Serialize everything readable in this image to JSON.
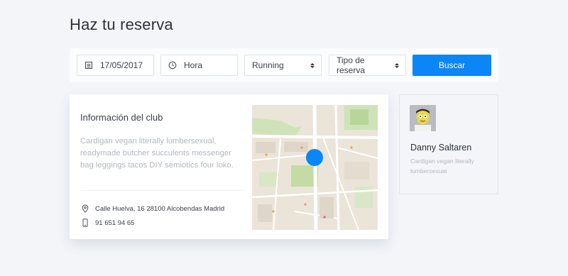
{
  "page": {
    "title": "Haz tu reserva"
  },
  "search": {
    "date_value": "17/05/2017",
    "hour_placeholder": "Hora",
    "sport_selected": "Running",
    "type_selected": "Tipo de reserva",
    "button_label": "Buscar",
    "accent_color": "#0a86f7"
  },
  "club": {
    "title": "Información del club",
    "description": "Cardigan vegan literally lumbersexual, readymade butcher succulents messenger bag leggings tacos DIY semiotics four loko.",
    "address": "Calle Huelva, 16 28100 Alcobendas Madrid",
    "phone": "91 651 94 65",
    "icons": {
      "address": "location-pin-icon",
      "phone": "mobile-phone-icon"
    }
  },
  "profile": {
    "name": "Danny Saltaren",
    "bio": "Cardigan vegan literally lumbersexual"
  },
  "icons": {
    "date": "calendar-icon",
    "hour": "clock-icon"
  }
}
